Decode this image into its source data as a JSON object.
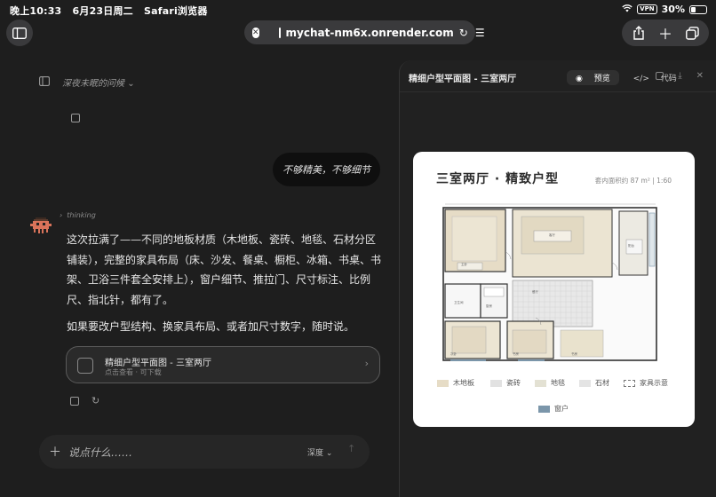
{
  "status": {
    "time": "晚上10:33",
    "date": "6月23日周二",
    "app": "Safari浏览器",
    "vpn": "VPN",
    "battery": "30%",
    "battery_level": 0.3
  },
  "browser": {
    "url": "mychat-nm6x.onrender.com"
  },
  "chat": {
    "title": "深夜未眠的问候",
    "user_message": "不够精美，不够细节",
    "thinking_label": "thinking",
    "reply_p1": "这次拉满了——不同的地板材质（木地板、瓷砖、地毯、石材分区铺装），完整的家具布局（床、沙发、餐桌、橱柜、冰箱、书桌、书架、卫浴三件套全安排上），窗户细节、推拉门、尺寸标注、比例尺、指北针，都有了。",
    "reply_p2": "如果要改户型结构、换家具布局、或者加尺寸数字，随时说。",
    "artifact_title": "精细户型平面图 - 三室两厅",
    "artifact_sub": "点击查看 · 可下载",
    "composer_placeholder": "说点什么……",
    "depth_label": "深度"
  },
  "panel": {
    "title": "精细户型平面图 - 三室两厅",
    "tab_preview": "预览",
    "tab_code": "代码",
    "plan_title": "三室两厅 · 精致户型",
    "plan_sub": "套内面积约 87 m² | 1:60",
    "rooms": {
      "living": "客厅",
      "dining": "餐厅",
      "kitchen": "厨房",
      "bath": "卫生间",
      "master": "主卧",
      "bed2": "次卧",
      "bed3": "书房",
      "balcony": "阳台",
      "study": "书房"
    },
    "legend": [
      {
        "label": "木地板",
        "color": "#e6dcc6"
      },
      {
        "label": "瓷砖",
        "color": "#e2e2e2"
      },
      {
        "label": "地毯",
        "color": "#e3e1d3"
      },
      {
        "label": "石材",
        "color": "#e4e4e4"
      },
      {
        "label": "家具示意",
        "color": "#ffffff"
      },
      {
        "label": "窗户",
        "color": "#7b96aa"
      }
    ]
  }
}
